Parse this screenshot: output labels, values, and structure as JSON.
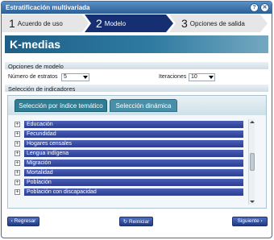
{
  "window": {
    "title": "Estratificación multivariada",
    "controls": [
      "?",
      "✕"
    ]
  },
  "steps": [
    {
      "num": "1",
      "label": "Acuerdo de uso"
    },
    {
      "num": "2",
      "label": "Modelo"
    },
    {
      "num": "3",
      "label": "Opciones de salida"
    }
  ],
  "banner": {
    "title": "K-medias"
  },
  "model_options": {
    "header": "Opciones de modelo",
    "strata_label": "Número de estratos",
    "strata_value": "5",
    "iterations_label": "Iteraciones",
    "iterations_value": "10"
  },
  "indicators": {
    "header": "Selección de indicadores",
    "tabs": [
      "Selección por índice temático",
      "Selección dinámica"
    ],
    "items": [
      {
        "toggle": "+",
        "label": "Educación"
      },
      {
        "toggle": "+",
        "label": "Fecundidad"
      },
      {
        "toggle": "+",
        "label": "Hogares censales"
      },
      {
        "toggle": "+",
        "label": "Lengua indígena"
      },
      {
        "toggle": "+",
        "label": "Migración"
      },
      {
        "toggle": "+",
        "label": "Mortalidad"
      },
      {
        "toggle": "+",
        "label": "Población"
      },
      {
        "toggle": "+",
        "label": "Población con discapacidad"
      }
    ]
  },
  "footer": {
    "back_label": "‹ Regresar",
    "reset_label": "↻ Reiniciar",
    "next_label": "Siguiente ›"
  },
  "colors": {
    "accent_navy": "#152f72",
    "banner_teal": "#1f5f87",
    "item_bar": "#2a3d92"
  }
}
